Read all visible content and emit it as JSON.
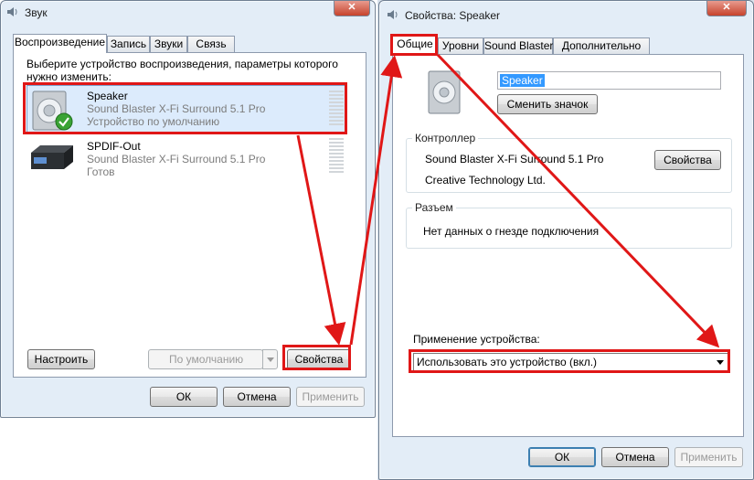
{
  "sound_window": {
    "title": "Звук",
    "close_label": "✕",
    "tabs": [
      "Воспроизведение",
      "Запись",
      "Звуки",
      "Связь"
    ],
    "instruction": "Выберите устройство воспроизведения, параметры которого нужно изменить:",
    "devices": [
      {
        "name": "Speaker",
        "driver": "Sound Blaster X-Fi Surround 5.1 Pro",
        "status": "Устройство по умолчанию"
      },
      {
        "name": "SPDIF-Out",
        "driver": "Sound Blaster X-Fi Surround 5.1 Pro",
        "status": "Готов"
      }
    ],
    "configure_label": "Настроить",
    "default_label": "По умолчанию",
    "properties_label": "Свойства",
    "ok_label": "ОК",
    "cancel_label": "Отмена",
    "apply_label": "Применить"
  },
  "props_window": {
    "title": "Свойства: Speaker",
    "close_label": "✕",
    "tabs": [
      "Общие",
      "Уровни",
      "Sound Blaster",
      "Дополнительно"
    ],
    "device_name_value": "Speaker",
    "change_icon_label": "Сменить значок",
    "controller": {
      "label": "Контроллер",
      "name": "Sound Blaster X-Fi Surround 5.1 Pro",
      "vendor": "Creative Technology Ltd.",
      "properties_label": "Свойства"
    },
    "jack": {
      "label": "Разъем",
      "info": "Нет данных о гнезде подключения"
    },
    "usage_label": "Применение устройства:",
    "usage_value": "Использовать это устройство (вкл.)",
    "ok_label": "ОК",
    "cancel_label": "Отмена",
    "apply_label": "Применить"
  },
  "colors": {
    "highlight": "#e01717",
    "window_bg": "#e3edf7",
    "selection": "#3399ff"
  }
}
